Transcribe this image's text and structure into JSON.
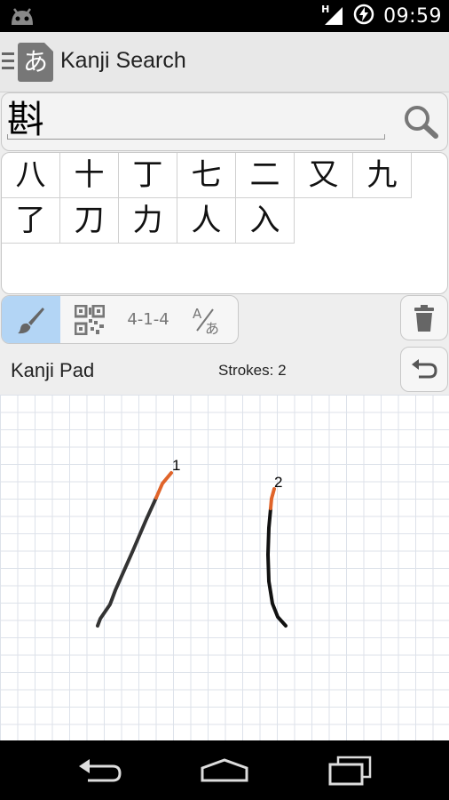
{
  "status_bar": {
    "time": "09:59",
    "network_label": "H"
  },
  "action_bar": {
    "app_icon_glyph": "あ",
    "title": "Kanji Search"
  },
  "search": {
    "query": "斟"
  },
  "results": [
    "八",
    "十",
    "丁",
    "七",
    "二",
    "又",
    "九",
    "了",
    "刀",
    "力",
    "人",
    "入"
  ],
  "modes": [
    {
      "name": "brush",
      "active": true
    },
    {
      "name": "qr-code",
      "active": false
    },
    {
      "name": "skip-code",
      "label": "4-1-4",
      "active": false
    },
    {
      "name": "romaji-kana",
      "active": false
    }
  ],
  "pad": {
    "label": "Kanji Pad",
    "strokes_label": "Strokes: 2",
    "stroke_numbers": [
      "1",
      "2"
    ]
  },
  "colors": {
    "active_mode": "#b3d5f5",
    "stroke": "#333333",
    "stroke_start": "#e0642a"
  }
}
